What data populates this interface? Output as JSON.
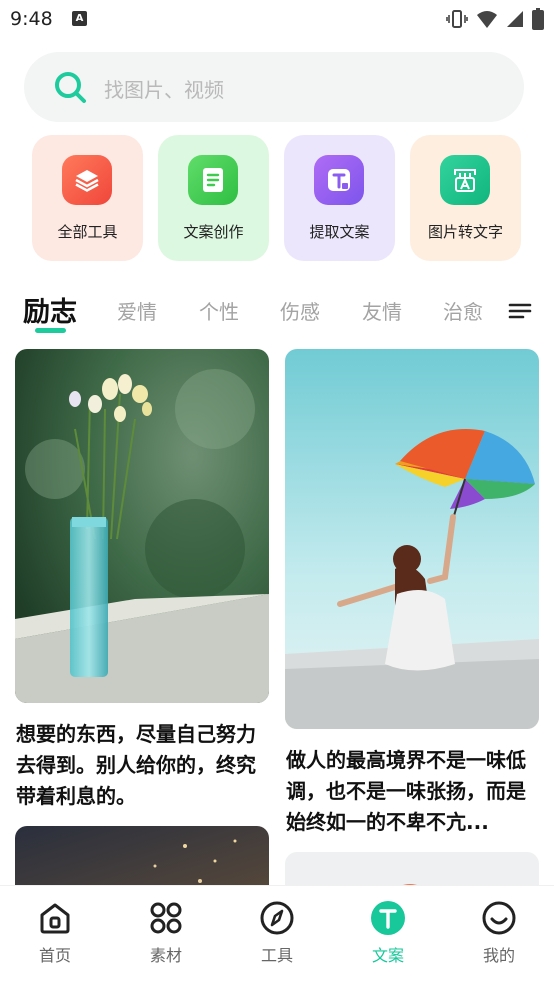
{
  "status_bar": {
    "time": "9:48",
    "notification_letter": "A"
  },
  "search": {
    "placeholder": "找图片、视频"
  },
  "tools": [
    {
      "label": "全部工具",
      "icon": "layers-icon",
      "bg": "#fde8e2",
      "icon_bg": "#f4553f"
    },
    {
      "label": "文案创作",
      "icon": "document-icon",
      "bg": "#ddf8e0",
      "icon_bg": "#3fcb4f"
    },
    {
      "label": "提取文案",
      "icon": "text-extract-icon",
      "bg": "#ece6fc",
      "icon_bg": "#8a5cf0"
    },
    {
      "label": "图片转文字",
      "icon": "image-to-text-icon",
      "bg": "#fdeee0",
      "icon_bg": "#19c18b"
    }
  ],
  "tabs": [
    {
      "label": "励志",
      "active": true
    },
    {
      "label": "爱情"
    },
    {
      "label": "个性"
    },
    {
      "label": "伤感"
    },
    {
      "label": "友情"
    },
    {
      "label": "治愈"
    }
  ],
  "feed": [
    {
      "text": "想要的东西，尽量自己努力去得到。别人给你的，终究带着利息的。",
      "image": "flowers-in-vase"
    },
    {
      "text": "做人的最高境界不是一味低调，也不是一味张扬，而是始终如一的不卑不亢...",
      "image": "girl-with-umbrella"
    }
  ],
  "bottom_nav": [
    {
      "label": "首页",
      "icon": "home-icon"
    },
    {
      "label": "素材",
      "icon": "grid-icon"
    },
    {
      "label": "工具",
      "icon": "compass-icon"
    },
    {
      "label": "文案",
      "icon": "text-icon",
      "active": true
    },
    {
      "label": "我的",
      "icon": "smile-icon"
    }
  ],
  "colors": {
    "accent": "#1ecb9d",
    "tab_inactive": "#a3a3a3"
  }
}
